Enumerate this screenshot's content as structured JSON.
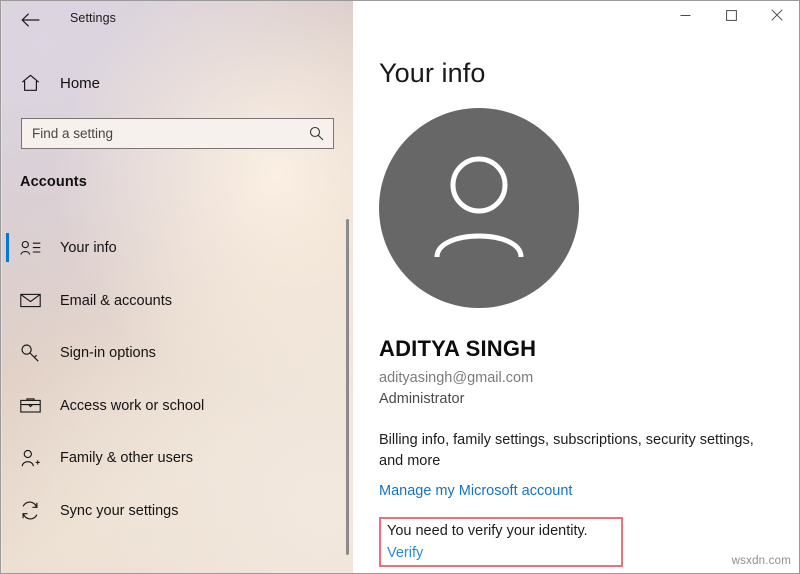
{
  "window": {
    "app_title": "Settings",
    "back_icon": "back-arrow-icon",
    "controls": {
      "minimize": "minimize-icon",
      "maximize": "maximize-icon",
      "close": "close-icon"
    }
  },
  "sidebar": {
    "home_label": "Home",
    "home_icon": "home-icon",
    "search": {
      "placeholder": "Find a setting",
      "value": "",
      "icon": "search-icon"
    },
    "section_title": "Accounts",
    "items": [
      {
        "label": "Your info",
        "icon": "contact-card-icon",
        "selected": true
      },
      {
        "label": "Email & accounts",
        "icon": "envelope-icon",
        "selected": false
      },
      {
        "label": "Sign-in options",
        "icon": "key-icon",
        "selected": false
      },
      {
        "label": "Access work or school",
        "icon": "briefcase-icon",
        "selected": false
      },
      {
        "label": "Family & other users",
        "icon": "add-user-icon",
        "selected": false
      },
      {
        "label": "Sync your settings",
        "icon": "sync-icon",
        "selected": false
      }
    ]
  },
  "main": {
    "page_title": "Your info",
    "avatar_icon": "person-avatar-icon",
    "account_name": "ADITYA SINGH",
    "account_email": "adityasingh@gmail.com",
    "account_role": "Administrator",
    "account_description": "Billing info, family settings, subscriptions, security settings, and more",
    "manage_link": "Manage my Microsoft account",
    "verify": {
      "message": "You need to verify your identity.",
      "link": "Verify"
    }
  },
  "watermark": "wsxdn.com",
  "colors": {
    "accent_blue": "#0078d7",
    "link_blue": "#1673c0",
    "verify_link_blue": "#2a8ae0",
    "callout_border_red": "#e8717c",
    "avatar_gray": "#676767"
  }
}
